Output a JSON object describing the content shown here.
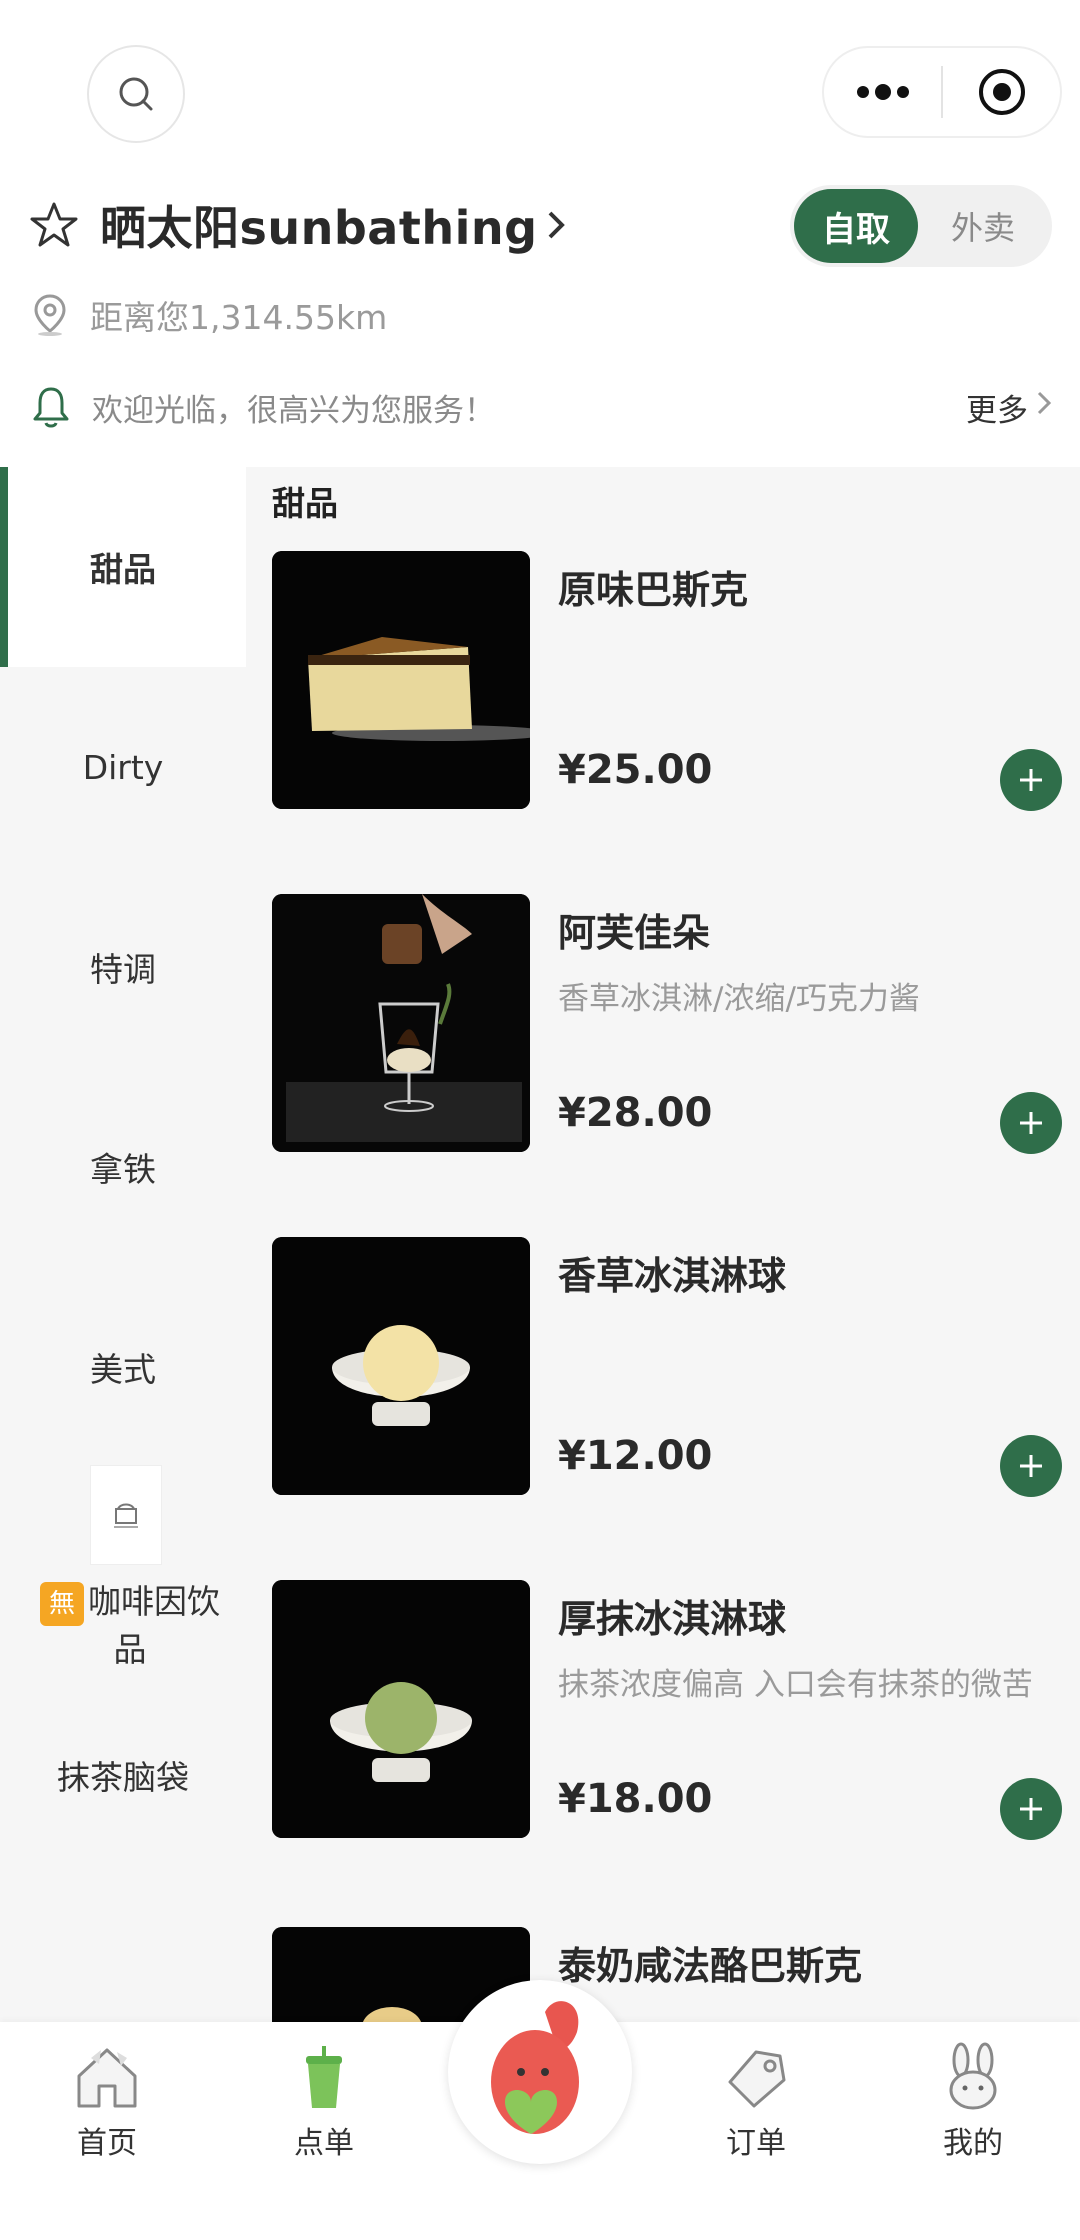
{
  "header": {
    "store_name": "晒太阳sunbathing",
    "distance": "距离您1,314.55km",
    "notice": "欢迎光临，很高兴为您服务！",
    "more_label": "更多",
    "mode_pickup": "自取",
    "mode_delivery": "外卖"
  },
  "sidebar": {
    "items": [
      {
        "label": "甜品"
      },
      {
        "label": "Dirty"
      },
      {
        "label": "特调"
      },
      {
        "label": "拿铁"
      },
      {
        "label": "美式"
      },
      {
        "label": "咖啡因饮品",
        "badge": "無"
      },
      {
        "label": "抹茶脑袋"
      }
    ]
  },
  "menu": {
    "section_title": "甜品",
    "items": [
      {
        "name": "原味巴斯克",
        "desc": "",
        "price": "¥25.00"
      },
      {
        "name": "阿芙佳朵",
        "desc": "香草冰淇淋/浓缩/巧克力酱",
        "price": "¥28.00"
      },
      {
        "name": "香草冰淇淋球",
        "desc": "",
        "price": "¥12.00"
      },
      {
        "name": "厚抹冰淇淋球",
        "desc": "抹茶浓度偏高 入口会有抹茶的微苦",
        "price": "¥18.00"
      },
      {
        "name": "泰奶咸法酪巴斯克",
        "desc": "",
        "price": ""
      }
    ]
  },
  "tabbar": {
    "home": "首页",
    "order": "点单",
    "orders": "订单",
    "mine": "我的"
  },
  "colors": {
    "accent": "#2f6e4a",
    "background": "#f6f6f6"
  }
}
